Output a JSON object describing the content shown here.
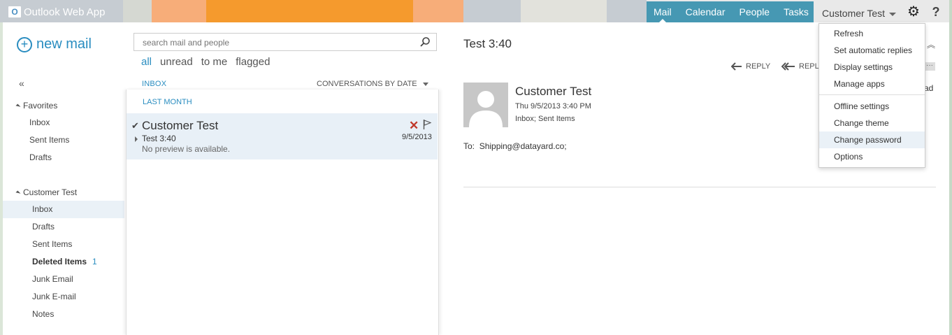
{
  "app": {
    "title": "Outlook Web App"
  },
  "topnav": {
    "items": [
      "Mail",
      "Calendar",
      "People",
      "Tasks"
    ],
    "active": "Mail"
  },
  "user": {
    "name": "Customer Test"
  },
  "colors": {
    "accent": "#2a8dc0",
    "topnav_bg": "#4698b3",
    "delete": "#c0392b",
    "selected_bg": "#e8f0f7"
  },
  "left": {
    "new_mail": "new mail",
    "collapse": "«",
    "favorites": {
      "header": "Favorites",
      "items": [
        "Inbox",
        "Sent Items",
        "Drafts"
      ]
    },
    "mailbox": {
      "header": "Customer Test",
      "items": [
        "Inbox",
        "Drafts",
        "Sent Items",
        "Deleted Items",
        "Junk Email",
        "Junk E-mail",
        "Notes"
      ],
      "deleted_count": "1"
    }
  },
  "middle": {
    "search_placeholder": "search mail and people",
    "filters": [
      "all",
      "unread",
      "to me",
      "flagged"
    ],
    "folder_label": "INBOX",
    "sort_label": "CONVERSATIONS BY DATE",
    "group_label": "LAST MONTH",
    "message": {
      "sender": "Customer Test",
      "subject": "Test 3:40",
      "preview": "No preview is available.",
      "date": "9/5/2013"
    }
  },
  "reading": {
    "title": "Test 3:40",
    "reply": "REPLY",
    "reply_all": "REPLY",
    "trunc": "ad",
    "from_name": "Customer Test",
    "date": "Thu 9/5/2013 3:40 PM",
    "folders": "Inbox; Sent Items",
    "to_label": "To:",
    "to_value": "Shipping@datayard.co;"
  },
  "menu": {
    "items": [
      "Refresh",
      "Set automatic replies",
      "Display settings",
      "Manage apps",
      "Offline settings",
      "Change theme",
      "Change password",
      "Options"
    ],
    "hovered": "Change password"
  }
}
